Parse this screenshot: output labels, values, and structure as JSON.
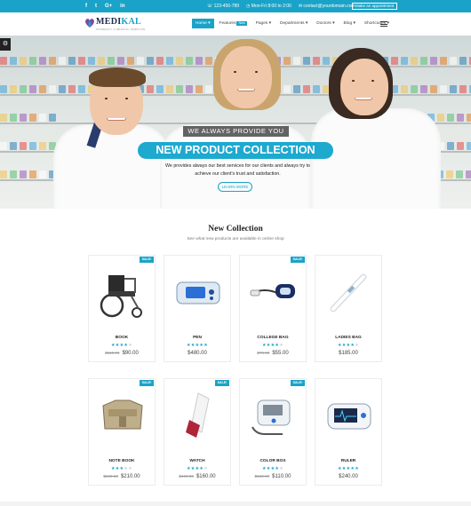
{
  "topbar": {
    "social_icons": [
      "facebook-icon",
      "twitter-icon",
      "google-plus-icon",
      "linkedin-icon"
    ],
    "social_glyphs": [
      "f",
      "t",
      "G+",
      "in"
    ],
    "phone": "123-456-789",
    "hours": "Mon-Fri 8:00 to 2:00",
    "email": "contact@yourdomain.com",
    "appointment_label": "Make an appointment"
  },
  "header": {
    "logo_name_a": "MEDI",
    "logo_name_b": "KAL",
    "logo_sub": "PHARMACY & MEDICAL TEMPLATE",
    "nav": [
      {
        "label": "Home ▾"
      },
      {
        "label": "Features",
        "badge": "New"
      },
      {
        "label": "Pages ▾"
      },
      {
        "label": "Departments ▾"
      },
      {
        "label": "Doctors ▾"
      },
      {
        "label": "Blog ▾"
      },
      {
        "label": "Shortcodes ▾"
      }
    ]
  },
  "hero": {
    "tagline": "WE ALWAYS PROVIDE YOU",
    "headline": "NEW PRODUCT COLLECTION",
    "text": "We provides always our best services for our clients and always try to achieve our client's trust and satisfaction.",
    "button": "LEARN MORE"
  },
  "collection": {
    "title": "New Collection",
    "subtitle": "See what new products are available in online shop",
    "sale_label": "SALE!",
    "products": [
      {
        "name": "BOOK",
        "old_price": "$110.00",
        "price": "$90.00",
        "sale": true,
        "rating": 4,
        "image": "wheelchair"
      },
      {
        "name": "PEN",
        "old_price": "",
        "price": "$480.00",
        "sale": false,
        "rating": 5,
        "image": "pulse-monitor"
      },
      {
        "name": "COLLEGE BAG",
        "old_price": "$70.00",
        "price": "$55.00",
        "sale": true,
        "rating": 4,
        "image": "blood-pressure-cuff"
      },
      {
        "name": "LADIES BAG",
        "old_price": "",
        "price": "$185.00",
        "sale": false,
        "rating": 4,
        "image": "thermometer"
      },
      {
        "name": "NOTE BOOK",
        "old_price": "$220.00",
        "price": "$210.00",
        "sale": true,
        "rating": 3,
        "image": "medical-vest"
      },
      {
        "name": "WATCH",
        "old_price": "$160.00",
        "price": "$160.00",
        "sale": true,
        "rating": 4,
        "image": "inhaler"
      },
      {
        "name": "COLOR BOX",
        "old_price": "$120.00",
        "price": "$110.00",
        "sale": true,
        "rating": 4,
        "image": "bp-monitor"
      },
      {
        "name": "RULER",
        "old_price": "",
        "price": "$240.00",
        "sale": false,
        "rating": 5,
        "image": "ecg-monitor"
      }
    ]
  }
}
